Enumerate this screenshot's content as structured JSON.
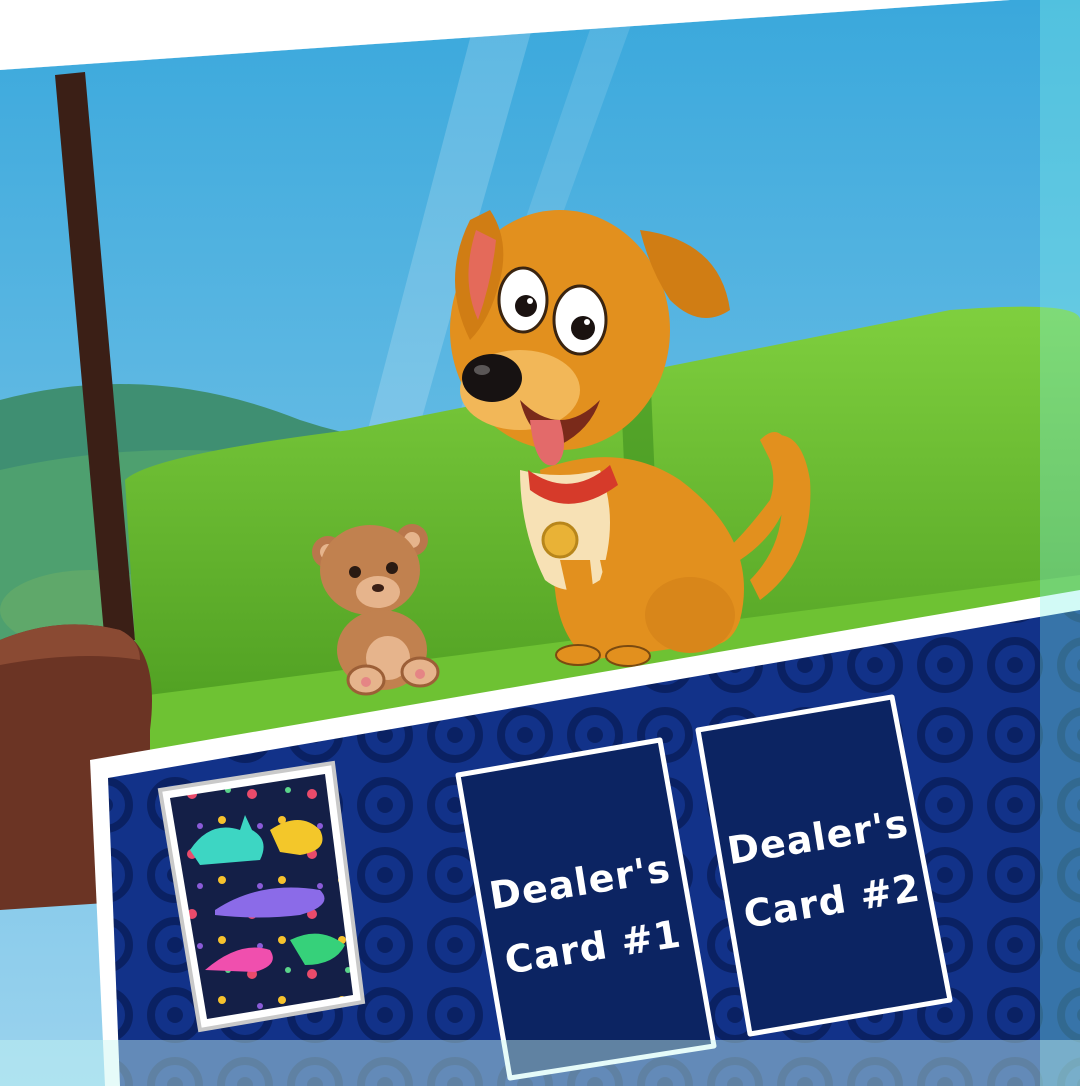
{
  "scene": {
    "characters": [
      "dog",
      "teddy-bear"
    ],
    "setting": "living room with green sofa and window"
  },
  "table": {
    "deck": {
      "back_pattern": "dinosaur-pattern"
    },
    "dealer_cards": [
      {
        "line1": "Dealer's",
        "line2": "Card #1"
      },
      {
        "line1": "Dealer's",
        "line2": "Card #2"
      }
    ]
  },
  "colors": {
    "table_blue": "#0f2d80",
    "card_fill": "#0c2462",
    "sofa_green": "#5cb52c",
    "dog_orange": "#e2901e",
    "sky_blue": "#58b6e1"
  }
}
